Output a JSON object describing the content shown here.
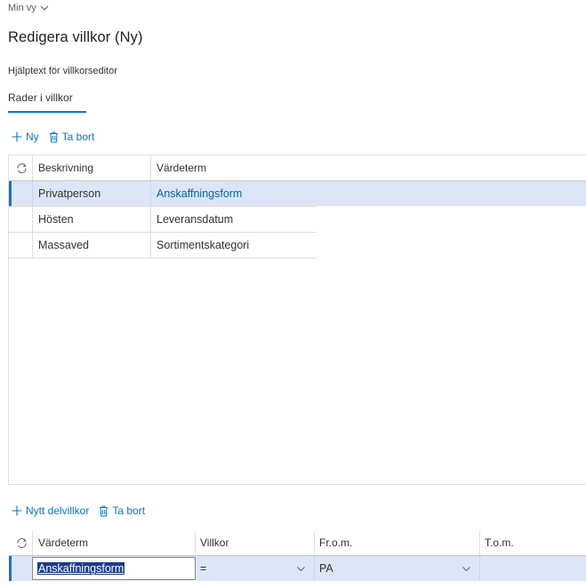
{
  "view": {
    "label": "Min vy"
  },
  "page": {
    "title": "Redigera villkor (Ny)",
    "helptext": "Hjälptext för villkorseditor",
    "tab": "Rader i villkor"
  },
  "toolbar1": {
    "new": "Ny",
    "delete": "Ta bort"
  },
  "grid1": {
    "columns": [
      "Beskrivning",
      "Värdeterm"
    ],
    "rows": [
      [
        "Privatperson",
        "Anskaffningsform"
      ],
      [
        "Hösten",
        "Leveransdatum"
      ],
      [
        "Massaved",
        "Sortimentskategori"
      ]
    ]
  },
  "toolbar2": {
    "new": "Nytt delvillkor",
    "delete": "Ta bort"
  },
  "grid2": {
    "columns": [
      "Värdeterm",
      "Villkor",
      "Fr.o.m.",
      "T.o.m."
    ],
    "row": {
      "term": "Anskaffningsform",
      "condition": "=",
      "from": "PA",
      "to": ""
    }
  },
  "colors": {
    "accent": "#0078d4",
    "selected_row": "#dce6f7"
  },
  "icons": [
    "chevron-down-icon",
    "plus-icon",
    "trash-icon",
    "refresh-icon"
  ]
}
